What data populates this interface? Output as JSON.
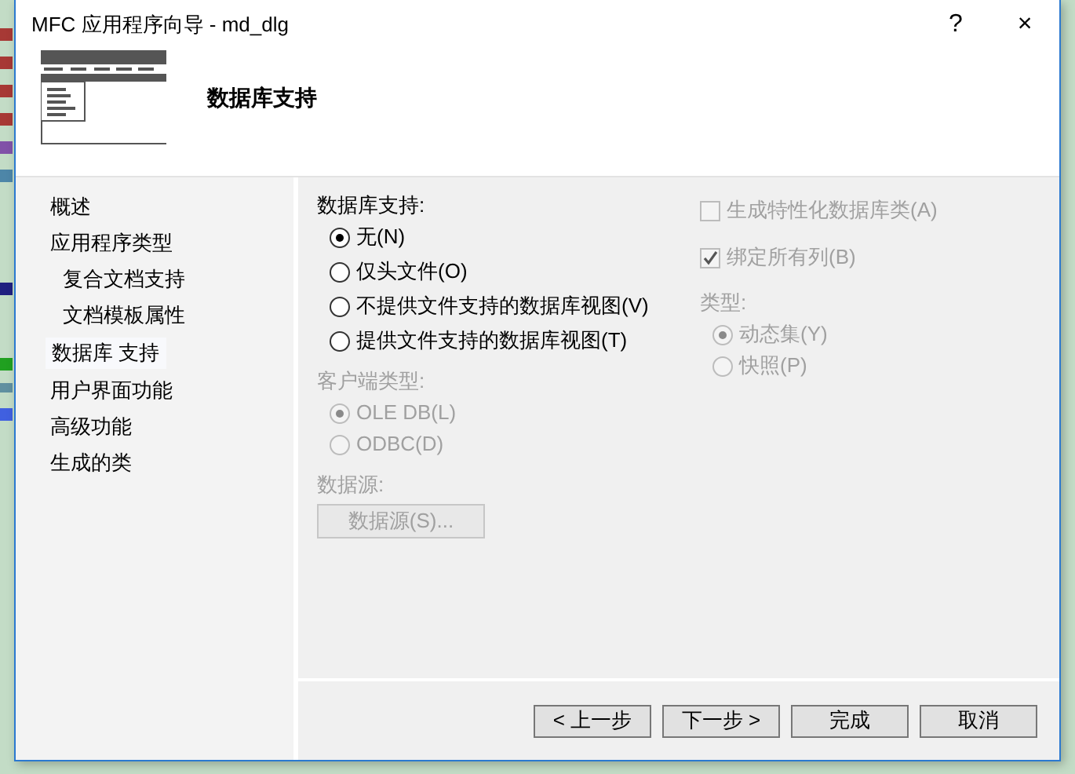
{
  "window": {
    "title": "MFC 应用程序向导 - md_dlg",
    "help_button": "?",
    "close_button": "×"
  },
  "header": {
    "heading": "数据库支持"
  },
  "nav": {
    "items": [
      {
        "label": "概述",
        "selected": false
      },
      {
        "label": "应用程序类型",
        "selected": false,
        "children": [
          {
            "label": "复合文档支持",
            "selected": false
          },
          {
            "label": "文档模板属性",
            "selected": false
          }
        ]
      },
      {
        "label": "数据库 支持",
        "selected": true
      },
      {
        "label": "用户界面功能",
        "selected": false
      },
      {
        "label": "高级功能",
        "selected": false
      },
      {
        "label": "生成的类",
        "selected": false
      }
    ]
  },
  "database_support": {
    "label": "数据库支持:",
    "disabled": false,
    "options": [
      {
        "label": "无(N)",
        "selected": true
      },
      {
        "label": "仅头文件(O)",
        "selected": false
      },
      {
        "label": "不提供文件支持的数据库视图(V)",
        "selected": false
      },
      {
        "label": "提供文件支持的数据库视图(T)",
        "selected": false
      }
    ]
  },
  "client_type": {
    "label": "客户端类型:",
    "disabled": true,
    "options": [
      {
        "label": "OLE DB(L)",
        "selected": true
      },
      {
        "label": "ODBC(D)",
        "selected": false
      }
    ]
  },
  "data_source": {
    "label": "数据源:",
    "button": "数据源(S)...",
    "disabled": true
  },
  "checkboxes": [
    {
      "label": "生成特性化数据库类(A)",
      "checked": false,
      "disabled": true
    },
    {
      "label": "绑定所有列(B)",
      "checked": true,
      "disabled": true
    }
  ],
  "recordset_type": {
    "label": "类型:",
    "disabled": true,
    "options": [
      {
        "label": "动态集(Y)",
        "selected": true
      },
      {
        "label": "快照(P)",
        "selected": false
      }
    ]
  },
  "buttons": [
    {
      "label": "< 上一步"
    },
    {
      "label": "下一步 >"
    },
    {
      "label": "完成"
    },
    {
      "label": "取消"
    }
  ]
}
